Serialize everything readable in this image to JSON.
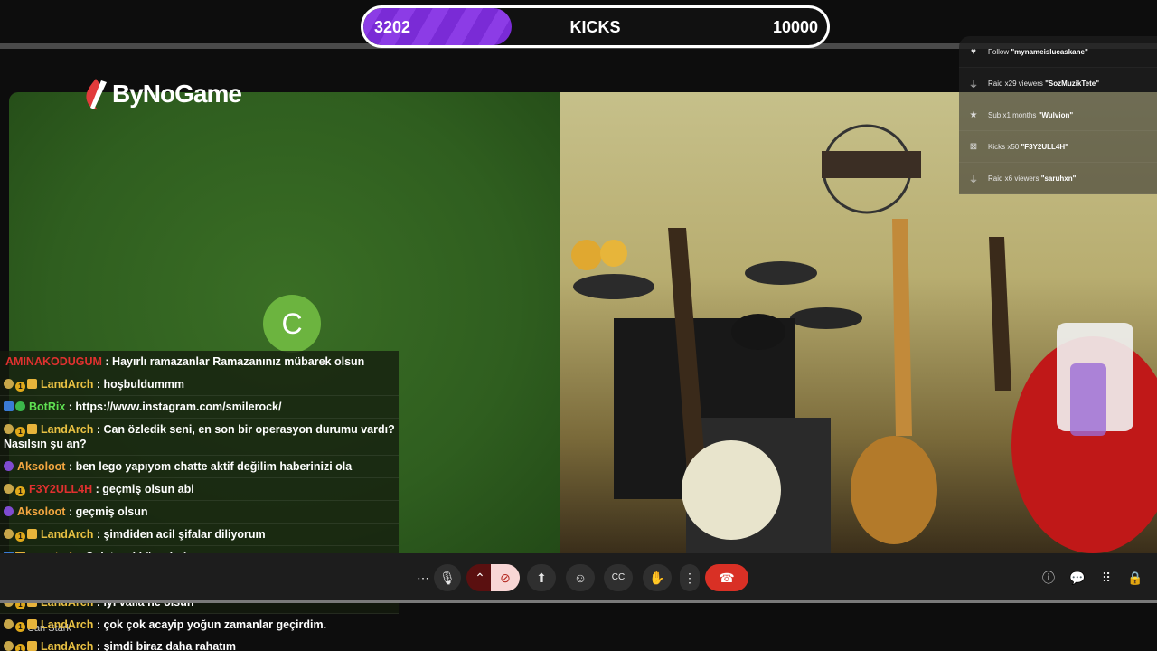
{
  "kicks": {
    "current": "3202",
    "title": "KICKS",
    "goal": "10000",
    "progress_fraction": 0.32,
    "fill_color": "#7a2bd6"
  },
  "brand": {
    "name": "ByNoGame",
    "icon": "flame-logo-icon"
  },
  "participant": {
    "initial": "C",
    "name": "Can Stark",
    "avatar_color": "#6cb43f"
  },
  "feed": [
    {
      "icon": "heart-icon",
      "prefix": "Follow ",
      "name": "\"mynameislucaskane\""
    },
    {
      "icon": "raid-icon",
      "prefix": "Raid x29 viewers ",
      "name": "\"SozMuzikTete\""
    },
    {
      "icon": "star-icon",
      "prefix": "Sub x1 months ",
      "name": "\"Wulvion\""
    },
    {
      "icon": "kick-icon",
      "prefix": "Kicks x50 ",
      "name": "\"F3Y2ULL4H\""
    },
    {
      "icon": "raid-icon",
      "prefix": "Raid x6 viewers ",
      "name": "\"saruhxn\""
    }
  ],
  "chat": [
    {
      "badges": [],
      "user": "AMINAKODUGUM",
      "color": "red",
      "message": "Hayırlı ramazanlar Ramazanınız mübarek olsun"
    },
    {
      "badges": [
        "gold",
        "one",
        "gift"
      ],
      "user": "LandArch",
      "color": "yellow",
      "message": "hoşbuldummm"
    },
    {
      "badges": [
        "blue",
        "green"
      ],
      "user": "BotRix",
      "color": "green",
      "message": "https://www.instagram.com/smilerock/"
    },
    {
      "badges": [
        "gold",
        "one",
        "gift"
      ],
      "user": "LandArch",
      "color": "yellow",
      "message": "Can özledik seni, en son bir operasyon durumu vardı? Nasılsın şu an?"
    },
    {
      "badges": [
        "purple"
      ],
      "user": "Aksoloot",
      "color": "orange",
      "message": "ben lego yapıyom chatte aktif değilim haberinizi ola"
    },
    {
      "badges": [
        "gold",
        "one"
      ],
      "user": "F3Y2ULL4H",
      "color": "red",
      "message": "geçmiş olsun abi"
    },
    {
      "badges": [
        "purple"
      ],
      "user": "Aksoloot",
      "color": "orange",
      "message": "geçmiş olsun"
    },
    {
      "badges": [
        "gold",
        "one",
        "gift"
      ],
      "user": "LandArch",
      "color": "yellow",
      "message": "şimdiden acil şifalar diliyorum"
    },
    {
      "badges": [
        "blue",
        "gift"
      ],
      "user": "canstark",
      "color": "orange",
      "message": "Çok teşekkür ederim"
    },
    {
      "badges": [
        "gold",
        "one",
        "gift"
      ],
      "user": "LandArch",
      "color": "yellow",
      "message": "👾"
    },
    {
      "badges": [
        "gold",
        "one",
        "gift"
      ],
      "user": "LandArch",
      "color": "yellow",
      "message": "iyi valla ne olsun"
    },
    {
      "badges": [
        "gold",
        "one",
        "gift"
      ],
      "user": "LandArch",
      "color": "yellow",
      "message": "çok çok acayip yoğun zamanlar geçirdim."
    },
    {
      "badges": [
        "gold",
        "one",
        "gift"
      ],
      "user": "LandArch",
      "color": "yellow",
      "message": "şimdi biraz daha rahatım"
    }
  ],
  "controls": {
    "more": "⋯",
    "mic": "🎙",
    "chevron": "⌃",
    "camera_off": "⊘",
    "present": "⬆",
    "emoji": "☺",
    "captions": "CC",
    "hand": "✋",
    "menu": "⋮",
    "hangup": "☎",
    "info": "ⓘ",
    "chat": "💬",
    "activities": "⠿",
    "lock": "🔒"
  }
}
